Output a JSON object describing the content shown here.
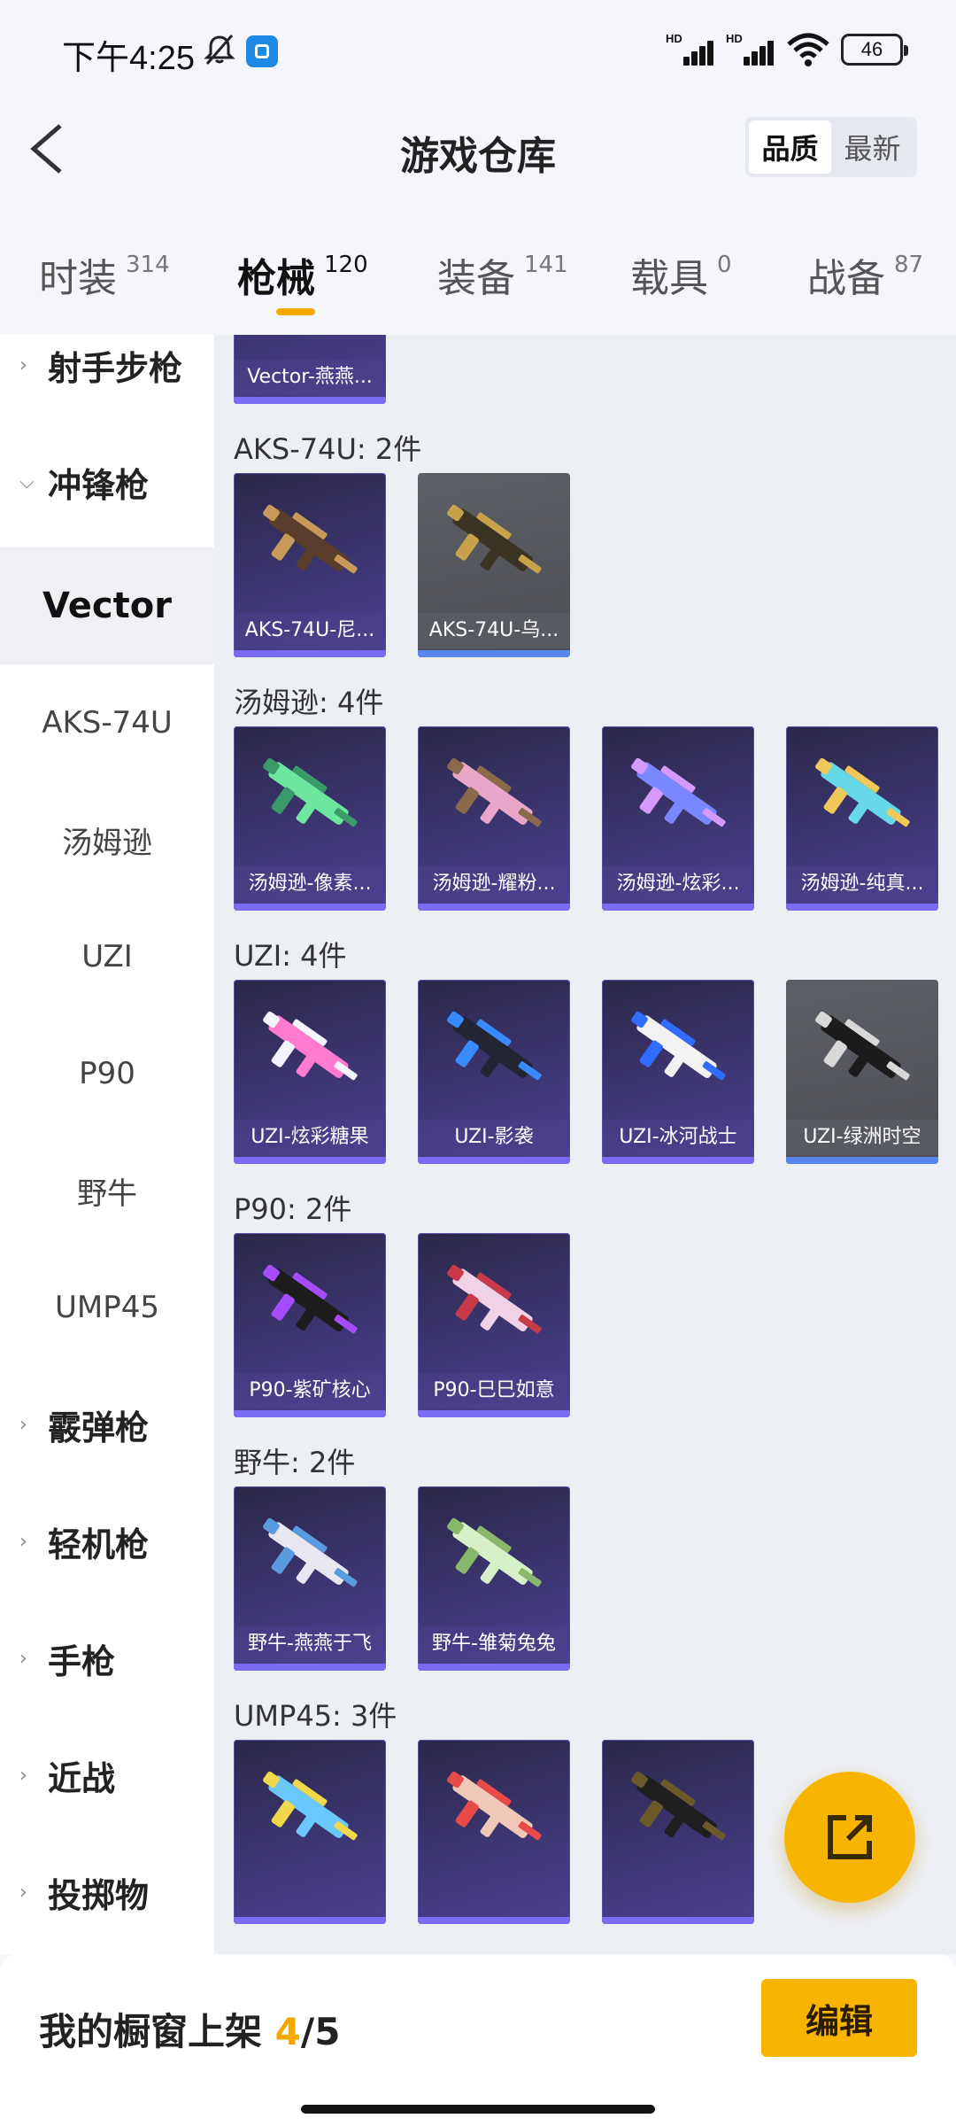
{
  "status_bar": {
    "time": "下午4:25",
    "battery": "46"
  },
  "header": {
    "title": "游戏仓库",
    "sort_options": [
      "品质",
      "最新"
    ]
  },
  "tabs": [
    {
      "label": "时装",
      "count": "314"
    },
    {
      "label": "枪械",
      "count": "120"
    },
    {
      "label": "装备",
      "count": "141"
    },
    {
      "label": "载具",
      "count": "0"
    },
    {
      "label": "战备",
      "count": "87"
    }
  ],
  "sidebar": {
    "items": [
      {
        "label": "射手步枪"
      },
      {
        "label": "冲锋枪"
      },
      {
        "label": "Vector"
      },
      {
        "label": "AKS-74U"
      },
      {
        "label": "汤姆逊"
      },
      {
        "label": "UZI"
      },
      {
        "label": "P90"
      },
      {
        "label": "野牛"
      },
      {
        "label": "UMP45"
      },
      {
        "label": "霰弹枪"
      },
      {
        "label": "轻机枪"
      },
      {
        "label": "手枪"
      },
      {
        "label": "近战"
      },
      {
        "label": "投掷物"
      }
    ]
  },
  "sections": [
    {
      "title": "",
      "items": [
        {
          "name": "Vector-燕燕..."
        }
      ]
    },
    {
      "title": "AKS-74U: 2件",
      "items": [
        {
          "name": "AKS-74U-尼..."
        },
        {
          "name": "AKS-74U-乌..."
        }
      ]
    },
    {
      "title": "汤姆逊: 4件",
      "items": [
        {
          "name": "汤姆逊-像素..."
        },
        {
          "name": "汤姆逊-耀粉..."
        },
        {
          "name": "汤姆逊-炫彩..."
        },
        {
          "name": "汤姆逊-纯真..."
        }
      ]
    },
    {
      "title": "UZI: 4件",
      "items": [
        {
          "name": "UZI-炫彩糖果"
        },
        {
          "name": "UZI-影袭"
        },
        {
          "name": "UZI-冰河战士"
        },
        {
          "name": "UZI-绿洲时空"
        }
      ]
    },
    {
      "title": "P90: 2件",
      "items": [
        {
          "name": "P90-紫矿核心"
        },
        {
          "name": "P90-巳巳如意"
        }
      ]
    },
    {
      "title": "野牛: 2件",
      "items": [
        {
          "name": "野牛-燕燕于飞"
        },
        {
          "name": "野牛-雏菊兔兔"
        }
      ]
    },
    {
      "title": "UMP45: 3件",
      "items": [
        {
          "name": ""
        },
        {
          "name": ""
        },
        {
          "name": ""
        }
      ]
    }
  ],
  "bottom_bar": {
    "shelf_label": "我的橱窗上架 ",
    "shelf_current": "4",
    "shelf_total": "/5",
    "edit_label": "编辑"
  },
  "colors": {
    "accent": "#f8b500",
    "card_purple": "#3d3672",
    "card_gray": "#55575d"
  }
}
